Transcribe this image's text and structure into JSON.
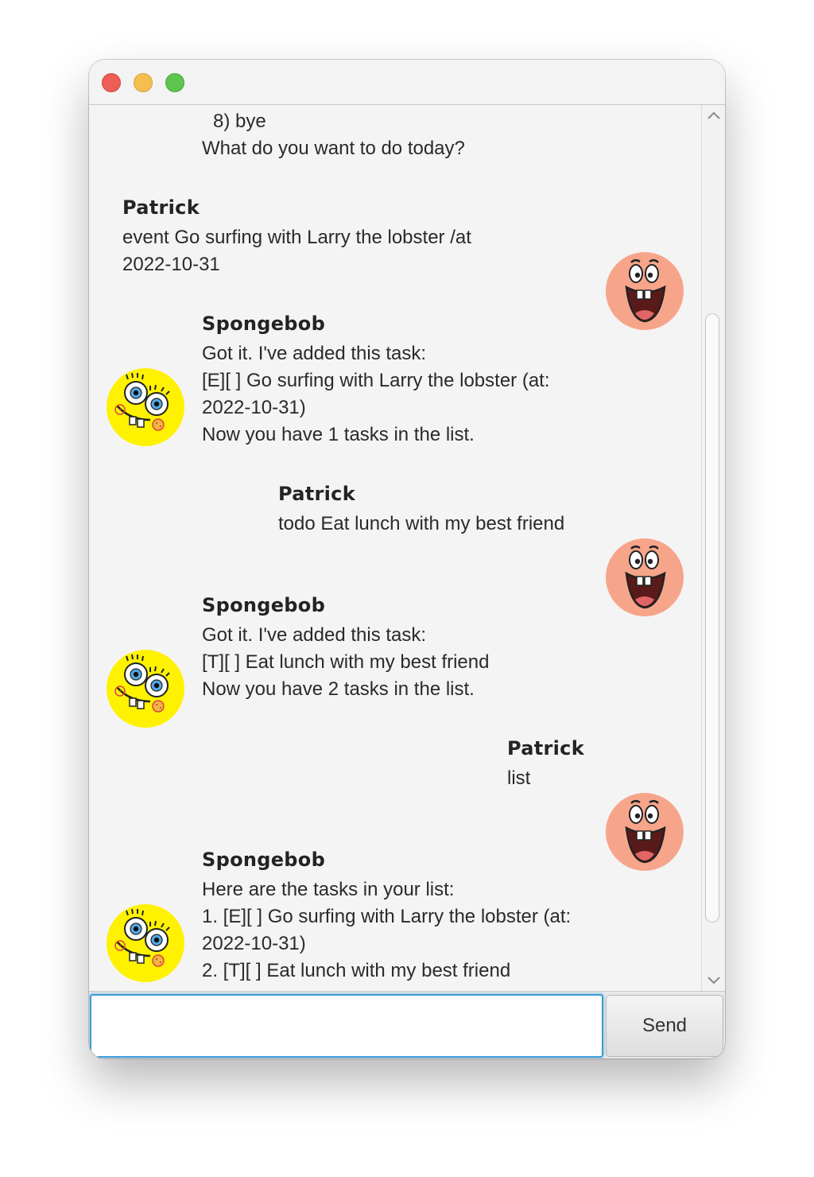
{
  "window": {
    "buttons": [
      "close",
      "minimize",
      "maximize"
    ]
  },
  "conversation": {
    "top_partial": {
      "lines": [
        "8) bye",
        "What do you want to do today?"
      ]
    },
    "messages": [
      {
        "sender": "Patrick",
        "lines": [
          "event Go surfing with Larry the lobster /at",
          "2022-10-31"
        ]
      },
      {
        "sender": "Spongebob",
        "lines": [
          "Got it. I've added this task:",
          "[E][ ] Go surfing with Larry the lobster (at:",
          "2022-10-31)",
          "Now you have 1 tasks in the list."
        ]
      },
      {
        "sender": "Patrick",
        "lines": [
          "todo Eat lunch with my best friend"
        ]
      },
      {
        "sender": "Spongebob",
        "lines": [
          "Got it. I've added this task:",
          "[T][ ] Eat lunch with my best friend",
          "Now you have 2 tasks in the list."
        ]
      },
      {
        "sender": "Patrick",
        "lines": [
          "list"
        ]
      },
      {
        "sender": "Spongebob",
        "lines": [
          "Here are the tasks in your list:",
          "1. [E][ ] Go surfing with Larry the lobster (at:",
          "2022-10-31)",
          "2. [T][ ] Eat lunch with my best friend"
        ]
      }
    ]
  },
  "input": {
    "value": "",
    "placeholder": ""
  },
  "send_button": {
    "label": "Send"
  },
  "colors": {
    "spongebob_yellow": "#fff200",
    "patrick_pink": "#f7a58a",
    "focus_blue": "#3b9bd8"
  }
}
